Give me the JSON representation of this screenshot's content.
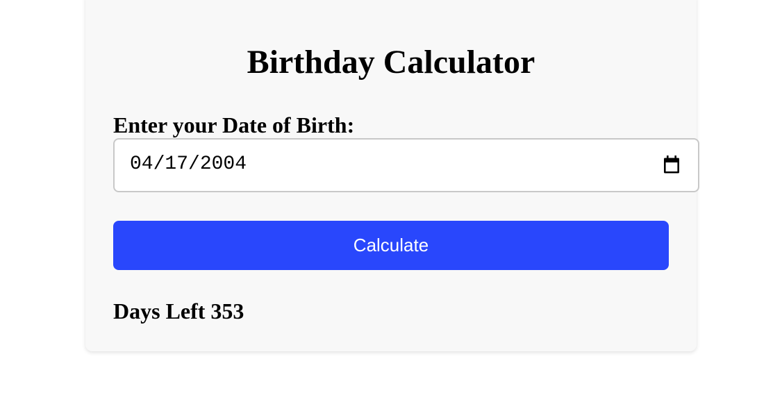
{
  "page": {
    "title": "Birthday Calculator"
  },
  "form": {
    "dob_label": "Enter your Date of Birth:",
    "dob_value": "04/17/2004",
    "calendar_icon": "calendar-icon",
    "calculate_label": "Calculate"
  },
  "result": {
    "text": "Days Left 353"
  },
  "colors": {
    "accent": "#2947fc",
    "card_background": "#f8f8f8"
  }
}
